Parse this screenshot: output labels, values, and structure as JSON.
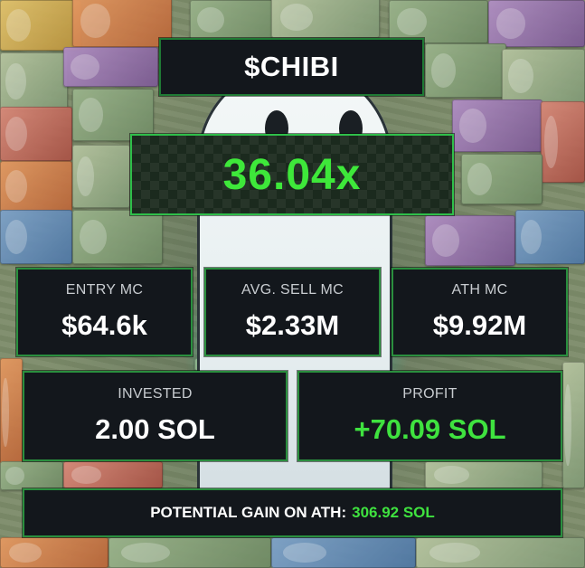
{
  "token": {
    "ticker": "$CHIBI"
  },
  "multiplier": "36.04x",
  "stats": {
    "entry_mc": {
      "label": "ENTRY MC",
      "value": "$64.6k"
    },
    "avg_sell_mc": {
      "label": "AVG. SELL MC",
      "value": "$2.33M"
    },
    "ath_mc": {
      "label": "ATH MC",
      "value": "$9.92M"
    },
    "invested": {
      "label": "INVESTED",
      "value": "2.00 SOL"
    },
    "profit": {
      "label": "PROFIT",
      "value": "+70.09 SOL"
    }
  },
  "potential_gain": {
    "label": "POTENTIAL GAIN ON ATH:",
    "value": "306.92 SOL"
  },
  "colors": {
    "accent_green": "#3fe23f",
    "panel_bg": "#13171c",
    "panel_border": "#2a8f3e"
  },
  "icons": {
    "mascot": "ghost-icon"
  }
}
